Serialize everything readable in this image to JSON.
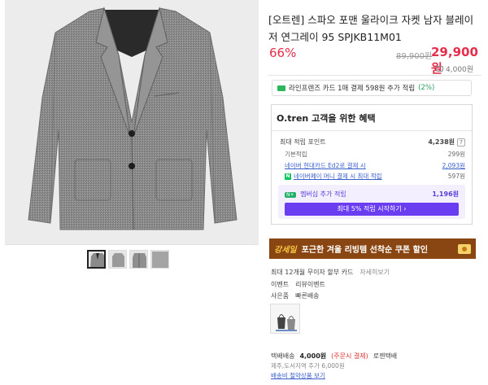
{
  "product": {
    "title": "[오트렌] 스파오 포맨 울라이크 자켓 남자 블레이저 연그레이 95 SPJKB11M01",
    "discount": "66%",
    "original_price": "89,900원",
    "sale_price": "29,900원",
    "point": "4,000원"
  },
  "card_promo": {
    "prefix": "라인프렌즈 카드 1매 결제 598원 추가 적립",
    "suffix": "(2%)"
  },
  "benefit": {
    "heading": "O.tren 고객을 위한 혜택",
    "max_point_label": "최대 적립 포인트",
    "max_point_value": "4,238원",
    "q_mark": "?",
    "basic_label": "기본적립",
    "basic_value": "299원",
    "hyundai_label": "네이버 현대카드 Ed2로 결제 시",
    "hyundai_value": "2,093원",
    "naverpay_badge": "N",
    "naverpay_label": "네이버페이 머니 결제 시 최대 적립",
    "naverpay_value": "597원",
    "member_badge": "N+",
    "member_label": "멤버십 추가 적립",
    "member_value": "1,196원",
    "member_button": "최대 5% 적립 시작하기 ›"
  },
  "banner": {
    "tag": "강세일",
    "text": "포근한 겨울 리빙템 선착순 쿠폰 할인"
  },
  "info": {
    "installment_label": "최대 12개월 무이자 할부 카드",
    "installment_link": "자세히보기",
    "event_label": "이벤트",
    "event_value": "리뷰이벤트",
    "gift_label": "사은품",
    "gift_value": "빠른배송"
  },
  "shipping": {
    "label": "택배배송",
    "fee": "4,000원",
    "condition": "(주문시 결제)",
    "carrier": "로젠택배",
    "extra": "제주,도서지역 추가 6,000원",
    "bundle_link": "배송비 절약상품 보기"
  },
  "colors": {
    "sale_red": "#e62d4b",
    "member_purple": "#6a3ef0",
    "banner_brown": "#8a4612",
    "naver_green": "#03c75a"
  }
}
